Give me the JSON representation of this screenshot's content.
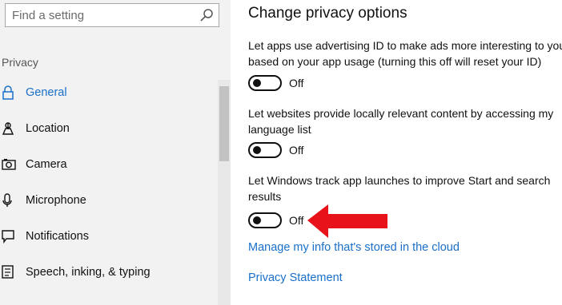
{
  "search": {
    "placeholder": "Find a setting"
  },
  "sidebar": {
    "section_label": "Privacy",
    "items": [
      {
        "label": "General",
        "icon": "lock-icon",
        "active": true
      },
      {
        "label": "Location",
        "icon": "location-icon"
      },
      {
        "label": "Camera",
        "icon": "camera-icon"
      },
      {
        "label": "Microphone",
        "icon": "microphone-icon"
      },
      {
        "label": "Notifications",
        "icon": "notifications-icon"
      },
      {
        "label": "Speech, inking, & typing",
        "icon": "speech-icon"
      }
    ]
  },
  "main": {
    "title": "Change privacy options",
    "options": [
      {
        "description_lines": [
          "Let apps use advertising ID to make ads more interesting to you",
          "based on your app usage (turning this off will reset your ID)"
        ],
        "state": "Off"
      },
      {
        "description_lines": [
          "Let websites provide locally relevant content by accessing my",
          "language list"
        ],
        "state": "Off"
      },
      {
        "description_lines": [
          "Let Windows track app launches to improve Start and search",
          "results"
        ],
        "state": "Off"
      }
    ],
    "links": {
      "manage": "Manage my info that's stored in the cloud",
      "privacy": "Privacy Statement"
    }
  },
  "colors": {
    "accent": "#1a6fc9",
    "annotation_arrow": "#e8121a",
    "sidebar_bg": "#f2f2f2"
  }
}
